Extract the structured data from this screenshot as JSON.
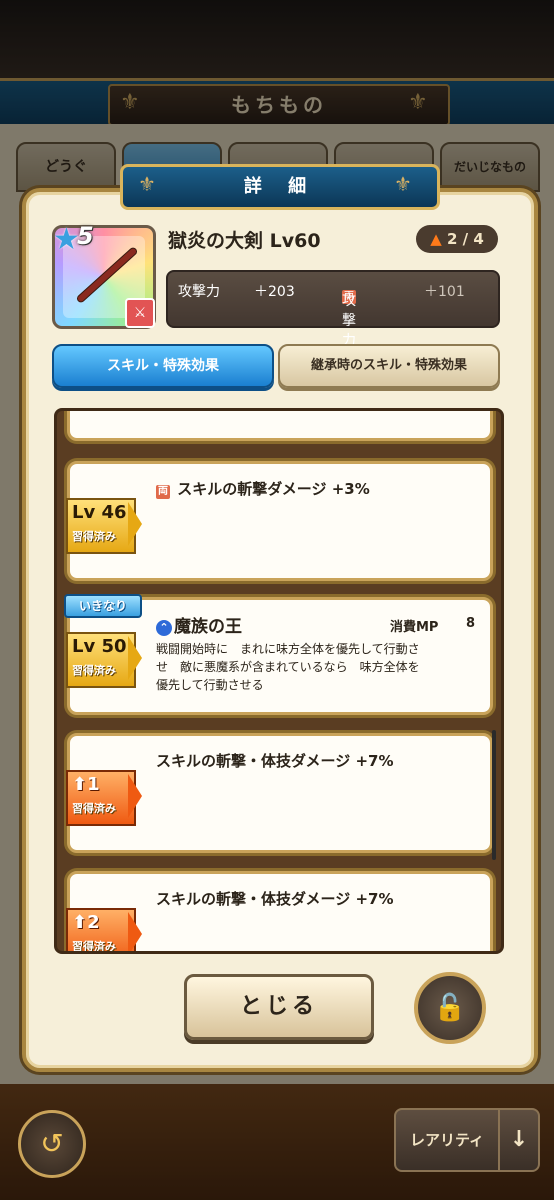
{
  "screen_title": "もちもの",
  "background_tabs": [
    "どうぐ",
    "",
    "",
    "",
    "だいじなもの"
  ],
  "dialog": {
    "title": "詳 細",
    "item": {
      "rarity_stars": "5",
      "name": "獄炎の大剣 Lv60",
      "upgrade": "2 / 4",
      "stats": {
        "attack_label": "攻撃力",
        "attack_value": "＋203",
        "both_label": "攻撃力",
        "both_value": "＋101"
      }
    },
    "tabs": {
      "active": "スキル・特殊効果",
      "inactive": "継承時のスキル・特殊効果"
    },
    "skills": [
      {
        "lv_main": "Lv 46",
        "lv_sub": "習得済み",
        "text": "スキルの斬撃ダメージ +3%",
        "both_icon": "両"
      },
      {
        "tag": "いきなり",
        "lv_main": "Lv 50",
        "lv_sub": "習得済み",
        "name": "魔族の王",
        "mp_label": "消費MP",
        "mp_value": "8",
        "desc_line1": "戦闘開始時に　まれに味方全体を優先して行動さ",
        "desc_line2": "せ　敵に悪魔系が含まれているなら　味方全体を",
        "desc_line3": "優先して行動させる"
      },
      {
        "lv_main": "1",
        "lv_sub": "習得済み",
        "text": "スキルの斬撃・体技ダメージ +7%"
      },
      {
        "lv_main": "2",
        "lv_sub": "習得済み",
        "text": "スキルの斬撃・体技ダメージ +7%"
      }
    ],
    "close_label": "とじる"
  },
  "bottom_bar": {
    "rarity_label": "レアリティ",
    "sort_icon": "↓"
  }
}
